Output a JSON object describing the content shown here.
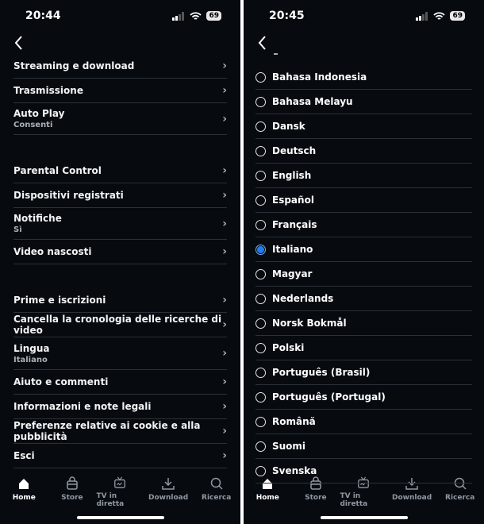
{
  "left": {
    "status": {
      "time": "20:44",
      "battery": "69"
    },
    "items": [
      {
        "label": "Streaming e download",
        "sub": ""
      },
      {
        "label": "Trasmissione",
        "sub": ""
      },
      {
        "label": "Auto Play",
        "sub": "Consenti"
      },
      {
        "label": "Parental Control",
        "sub": ""
      },
      {
        "label": "Dispositivi registrati",
        "sub": ""
      },
      {
        "label": "Notifiche",
        "sub": "Sì"
      },
      {
        "label": "Video nascosti",
        "sub": ""
      },
      {
        "label": "Prime e iscrizioni",
        "sub": ""
      },
      {
        "label": "Cancella la cronologia delle ricerche di video",
        "sub": ""
      },
      {
        "label": "Lingua",
        "sub": "Italiano"
      },
      {
        "label": "Aiuto e commenti",
        "sub": ""
      },
      {
        "label": "Informazioni e note legali",
        "sub": ""
      },
      {
        "label": "Preferenze relative ai cookie e alla pubblicità",
        "sub": ""
      },
      {
        "label": "Esci",
        "sub": ""
      }
    ]
  },
  "right": {
    "status": {
      "time": "20:45",
      "battery": "69"
    },
    "selected": "Italiano",
    "accent": "#1f7cf0",
    "languages": [
      "Bahasa Indonesia",
      "Bahasa Melayu",
      "Dansk",
      "Deutsch",
      "English",
      "Español",
      "Français",
      "Italiano",
      "Magyar",
      "Nederlands",
      "Norsk Bokmål",
      "Polski",
      "Português (Brasil)",
      "Português (Portugal)",
      "Română",
      "Suomi",
      "Svenska"
    ]
  },
  "tabs": [
    {
      "label": "Home",
      "icon": "home-icon",
      "active": true
    },
    {
      "label": "Store",
      "icon": "bag-icon"
    },
    {
      "label": "TV in diretta",
      "icon": "tv-icon"
    },
    {
      "label": "Download",
      "icon": "download-icon"
    },
    {
      "label": "Ricerca",
      "icon": "search-icon"
    }
  ]
}
